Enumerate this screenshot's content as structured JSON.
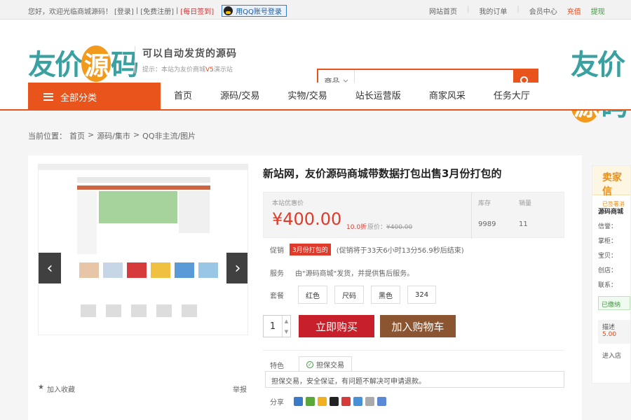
{
  "topbar": {
    "greeting": "您好，欢迎光临商城源码！",
    "login": "[登录]",
    "register": "[免费注册]",
    "signin": "[每日签到]",
    "qq_login": "用QQ账号登录",
    "links": [
      "网站首页",
      "我的订单",
      "会员中心",
      "充值",
      "提现"
    ]
  },
  "header": {
    "logo_text": "友价源码",
    "slogan": "可以自动发货的源码",
    "tip_prefix": "提示：本站为友价商城",
    "tip_highlight": "V5",
    "tip_suffix": "演示站",
    "search": {
      "category": "商品",
      "placeholder": ""
    }
  },
  "nav": {
    "all_categories": "全部分类",
    "items": [
      "首页",
      "源码/交易",
      "实物/交易",
      "站长运营版",
      "商家风采",
      "任务大厅"
    ]
  },
  "breadcrumb": {
    "label": "当前位置：",
    "items": [
      "首页",
      ">",
      "源码/集市",
      ">",
      "QQ非主流/图片"
    ]
  },
  "gallery": {
    "favorite": "加入收藏",
    "report": "举报"
  },
  "product": {
    "title": "新站网，友价源码商城带数据打包出售3月份打包的",
    "price_label": "本站优惠价",
    "price": "¥400.00",
    "discount": "10.0折",
    "original_label": "原价：",
    "original_price": "¥400.00",
    "stock_label": "库存",
    "stock_value": "9989",
    "sales_label": "销量",
    "sales_value": "11",
    "promo_label": "促销",
    "promo_tag": "3月份打包的",
    "promo_text": "(促销将于33天6小时13分56.9秒后结束)",
    "service_label": "服务",
    "service_text": "由\"源码商城\"发货，并提供售后服务。",
    "package_label": "套餐",
    "packages": [
      "红色",
      "尺码",
      "黑色",
      "324"
    ],
    "quantity": "1",
    "buy_now": "立即购买",
    "add_cart": "加入购物车",
    "feature_label": "特色",
    "feature_tab": "担保交易",
    "feature_text": "担保交易，安全保证，有问题不解决可申请退款。",
    "share_label": "分享"
  },
  "seller": {
    "title": "卖家信",
    "subtitle": "已签署消",
    "shop": "源码商城",
    "fields": [
      "信誉：",
      "掌柜：",
      "宝贝：",
      "创店：",
      "联系："
    ],
    "verified": "已缴纳",
    "score_label": "描述",
    "score_value": "5.00",
    "enter": "进入店"
  },
  "colors": {
    "accent": "#e8541c",
    "price": "#e03a2a",
    "buy": "#c7202a",
    "cart": "#8a5530"
  }
}
